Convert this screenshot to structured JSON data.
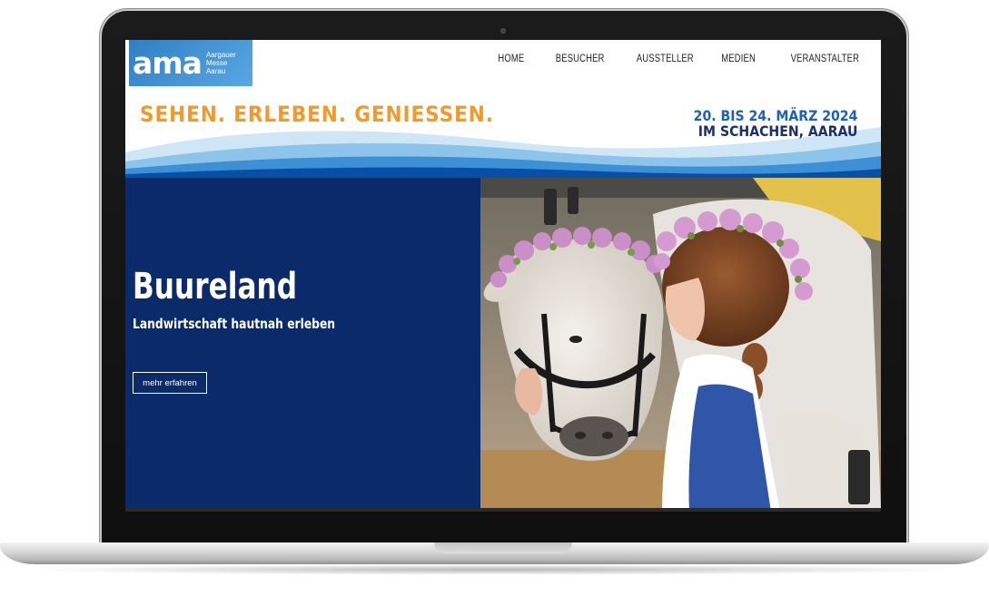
{
  "header": {
    "logo": {
      "word": "ama",
      "lines": [
        "Aargauer",
        "Messe",
        "Aarau"
      ]
    },
    "nav": [
      {
        "label": "HOME"
      },
      {
        "label": "BESUCHER"
      },
      {
        "label": "AUSSTELLER"
      },
      {
        "label": "MEDIEN"
      },
      {
        "label": "VERANSTALTER"
      }
    ],
    "slogan": "SEHEN. ERLEBEN. GENIESSEN.",
    "date_line1": "20. BIS 24. MÄRZ 2024",
    "date_line2": "IM SCHACHEN, AARAU"
  },
  "hero": {
    "title": "Buureland",
    "subtitle": "Landwirtschaft hautnah erleben",
    "button_label": "mehr erfahren",
    "image_alt": "girl-with-flower-crown-and-calf-photo"
  },
  "colors": {
    "brand_blue": "#0a2a6a",
    "logo_blue": "#3a8ad0",
    "slogan_orange": "#f09a2a",
    "date_blue": "#1f5fb8"
  }
}
